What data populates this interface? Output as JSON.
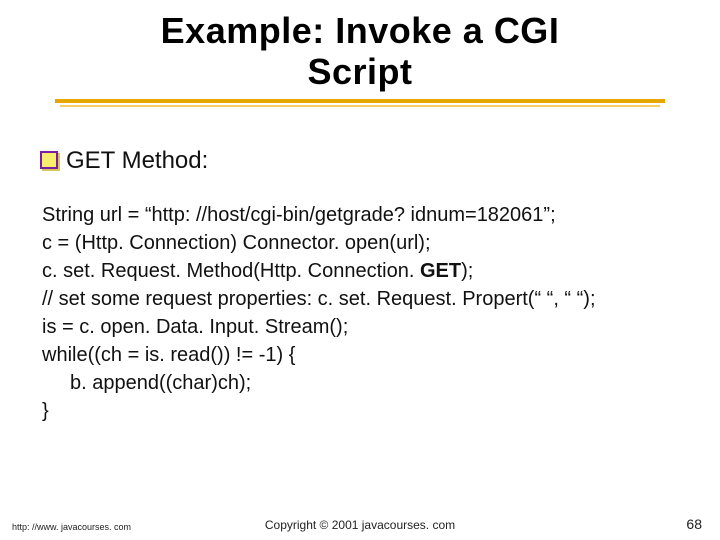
{
  "title": {
    "line1": "Example: Invoke a CGI",
    "line2": "Script"
  },
  "subhead": "GET Method:",
  "code": {
    "l1": "String url = “http: //host/cgi-bin/getgrade? idnum=182061”;",
    "l2": "c = (Http. Connection) Connector. open(url);",
    "l3a": "c. set. Request. Method(Http. Connection. ",
    "l3b": "GET",
    "l3c": ");",
    "l4": "// set some request properties: c. set. Request. Propert(“ “, “ “);",
    "l5": "is = c. open. Data. Input. Stream();",
    "l6": "while((ch = is. read()) != -1) {",
    "l7": "b. append((char)ch);",
    "l8": "}"
  },
  "footer": {
    "left": "http: //www. javacourses. com",
    "center": "Copyright © 2001 javacourses. com",
    "page": "68"
  }
}
